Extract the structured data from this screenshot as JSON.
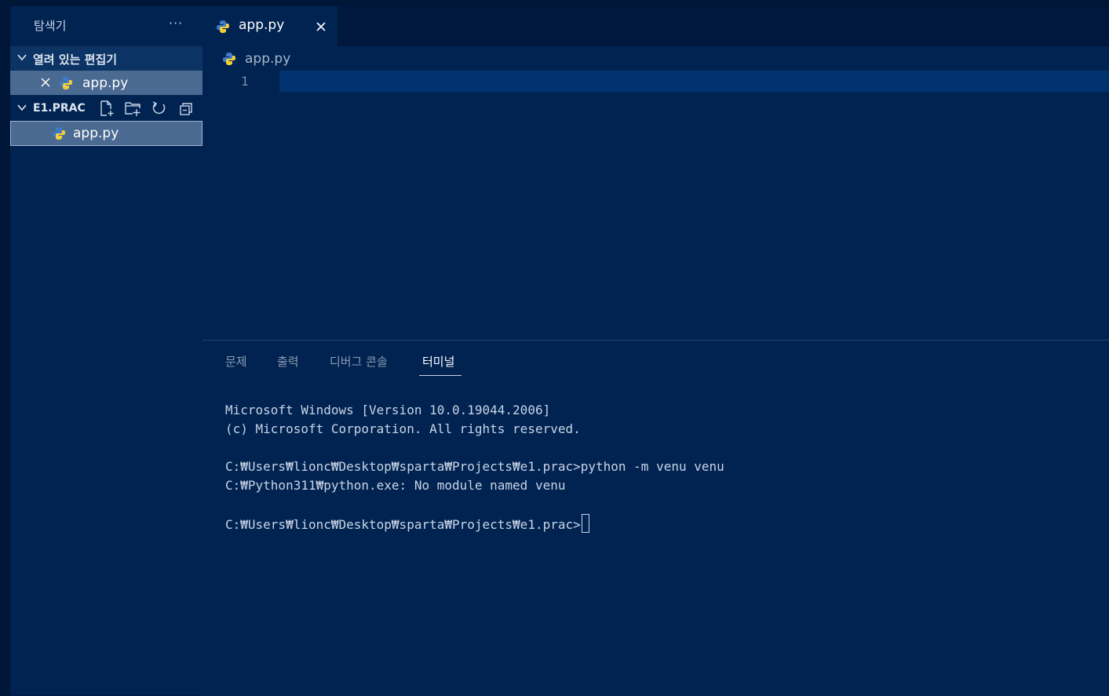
{
  "sidebar": {
    "title": "탐색기",
    "more": "···",
    "open_editors": {
      "label": "열려 있는 편집기",
      "files": [
        {
          "name": "app.py"
        }
      ]
    },
    "project": {
      "label": "E1.PRAC",
      "files": [
        {
          "name": "app.py"
        }
      ]
    }
  },
  "editor": {
    "tab": {
      "label": "app.py"
    },
    "breadcrumb": "app.py",
    "line_numbers": [
      "1"
    ]
  },
  "panel": {
    "tabs": [
      "문제",
      "출력",
      "디버그 콘솔",
      "터미널"
    ],
    "active_tab": "터미널",
    "terminal_lines": [
      "Microsoft Windows [Version 10.0.19044.2006]",
      "(c) Microsoft Corporation. All rights reserved.",
      "",
      "C:₩Users₩lionc₩Desktop₩sparta₩Projects₩e1.prac>python -m venu venu",
      "C:₩Python311₩python.exe: No module named venu",
      "",
      "C:₩Users₩lionc₩Desktop₩sparta₩Projects₩e1.prac>"
    ]
  },
  "colors": {
    "background": "#001a3f",
    "sidebar": "#002352",
    "selection": "#4a6a92",
    "current_line": "#003270"
  }
}
